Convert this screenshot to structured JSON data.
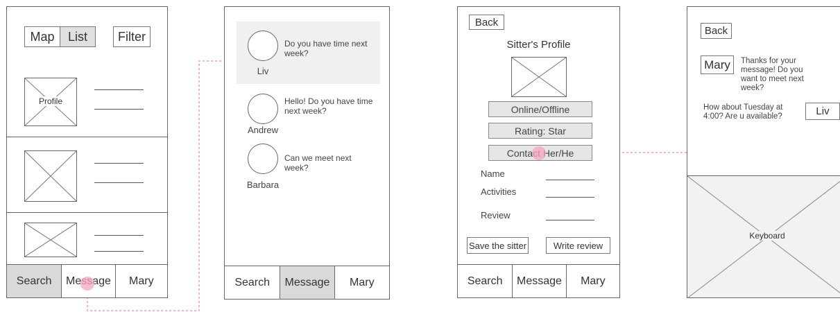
{
  "colors": {
    "connector": "#f08aa8",
    "tap": "#f5a5c0",
    "selected": "#d9d9d9",
    "row_highlight": "#f0f0f0"
  },
  "screen1": {
    "toggle_map": "Map",
    "toggle_list": "List",
    "filter": "Filter",
    "card1_label": "Profile",
    "tabs": [
      "Search",
      "Message",
      "Mary"
    ]
  },
  "screen2": {
    "messages": [
      {
        "name": "Liv",
        "text": "Do you have time next week?"
      },
      {
        "name": "Andrew",
        "text": "Hello! Do you have time next week?"
      },
      {
        "name": "Barbara",
        "text": "Can we meet next week?"
      }
    ],
    "tabs": [
      "Search",
      "Message",
      "Mary"
    ]
  },
  "screen3": {
    "back": "Back",
    "title": "Sitter's Profile",
    "status": "Online/Offline",
    "rating": "Rating: Star",
    "contact": "Contact Her/He",
    "fields": [
      "Name",
      "Activities",
      "Review"
    ],
    "save": "Save the sitter",
    "write_review": "Write review",
    "tabs": [
      "Search",
      "Message",
      "Mary"
    ]
  },
  "screen4": {
    "back": "Back",
    "sender": "Mary",
    "incoming": "Thanks for your message! Do you want to meet next week?",
    "reply": "How about Tuesday at 4:00? Are u available?",
    "reply_sender": "Liv",
    "keyboard": "Keyboard"
  }
}
